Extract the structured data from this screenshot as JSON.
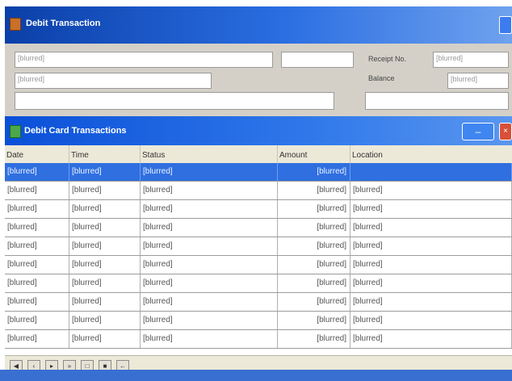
{
  "window": {
    "title": "Debit Transaction"
  },
  "header": {
    "name_line1": "[blurred]",
    "name_line2": "[blurred]",
    "receipt_label": "Receipt No.",
    "receipt_value": "[blurred]",
    "balance_label": "Balance",
    "balance_value": "[blurred]"
  },
  "debit": {
    "title": "Debit Card Transactions",
    "min_glyph": "–",
    "close_glyph": "×",
    "columns": [
      "Date",
      "Time",
      "Status",
      "Amount",
      "Location"
    ],
    "rows": [
      {
        "date": "[blurred]",
        "time": "[blurred]",
        "status": "[blurred]",
        "amount": "[blurred]",
        "location": ""
      },
      {
        "date": "[blurred]",
        "time": "[blurred]",
        "status": "[blurred]",
        "amount": "[blurred]",
        "location": "[blurred]"
      },
      {
        "date": "[blurred]",
        "time": "[blurred]",
        "status": "[blurred]",
        "amount": "[blurred]",
        "location": "[blurred]"
      },
      {
        "date": "[blurred]",
        "time": "[blurred]",
        "status": "[blurred]",
        "amount": "[blurred]",
        "location": "[blurred]"
      },
      {
        "date": "[blurred]",
        "time": "[blurred]",
        "status": "[blurred]",
        "amount": "[blurred]",
        "location": "[blurred]"
      },
      {
        "date": "[blurred]",
        "time": "[blurred]",
        "status": "[blurred]",
        "amount": "[blurred]",
        "location": "[blurred]"
      },
      {
        "date": "[blurred]",
        "time": "[blurred]",
        "status": "[blurred]",
        "amount": "[blurred]",
        "location": "[blurred]"
      },
      {
        "date": "[blurred]",
        "time": "[blurred]",
        "status": "[blurred]",
        "amount": "[blurred]",
        "location": "[blurred]"
      },
      {
        "date": "[blurred]",
        "time": "[blurred]",
        "status": "[blurred]",
        "amount": "[blurred]",
        "location": "[blurred]"
      },
      {
        "date": "[blurred]",
        "time": "[blurred]",
        "status": "[blurred]",
        "amount": "[blurred]",
        "location": "[blurred]"
      }
    ],
    "nav_glyphs": [
      "◀",
      "‹",
      "▸",
      "»",
      "□",
      "■",
      "←"
    ]
  },
  "colors": {
    "titlebar": "#0b3fa8",
    "selected_row": "#2f6fe0",
    "window_bg": "#d4d0c8"
  },
  "icons": {
    "window": "app-window-icon",
    "debit": "card-list-icon"
  }
}
